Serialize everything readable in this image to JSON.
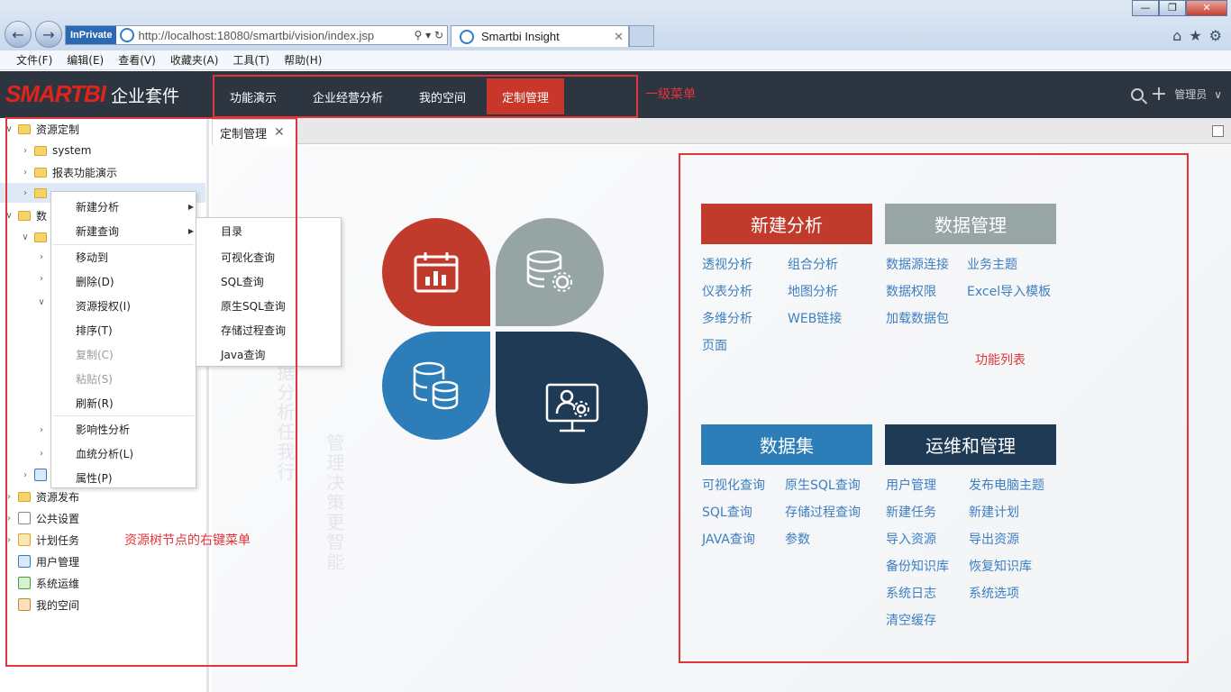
{
  "browser": {
    "inprivate": "InPrivate",
    "url": "http://localhost:18080/smartbi/vision/index.jsp",
    "tab_title": "Smartbi Insight",
    "menu": [
      "文件(F)",
      "编辑(E)",
      "查看(V)",
      "收藏夹(A)",
      "工具(T)",
      "帮助(H)"
    ]
  },
  "app": {
    "logo": "SMARTBI",
    "logo_suffix": "企业套件",
    "top_menu": [
      "功能演示",
      "企业经营分析",
      "我的空间",
      "定制管理"
    ],
    "active_menu": "定制管理",
    "user": "管理员"
  },
  "tree": {
    "items": [
      {
        "label": "资源定制"
      },
      {
        "label": "system"
      },
      {
        "label": "报表功能演示"
      },
      {
        "label": "数"
      },
      {
        "label": "资源发布"
      },
      {
        "label": "公共设置"
      },
      {
        "label": "计划任务"
      },
      {
        "label": "用户管理"
      },
      {
        "label": "系统运维"
      },
      {
        "label": "我的空间"
      }
    ]
  },
  "doc_tab": {
    "label": "定制管理"
  },
  "context_menu": {
    "items": [
      "新建分析",
      "新建查询",
      "移动到",
      "删除(D)",
      "资源授权(I)",
      "排序(T)",
      "复制(C)",
      "粘贴(S)",
      "刷新(R)",
      "影响性分析",
      "血统分析(L)",
      "属性(P)"
    ],
    "submenu": [
      "目录",
      "可视化查询",
      "SQL查询",
      "原生SQL查询",
      "存储过程查询",
      "Java查询"
    ]
  },
  "sections": {
    "new_analysis": {
      "title": "新建分析",
      "links": [
        "透视分析",
        "组合分析",
        "仪表分析",
        "地图分析",
        "多维分析",
        "WEB链接",
        "页面"
      ]
    },
    "data_mgmt": {
      "title": "数据管理",
      "links": [
        "数据源连接",
        "业务主题",
        "数据权限",
        "Excel导入模板",
        "加载数据包"
      ]
    },
    "dataset": {
      "title": "数据集",
      "links": [
        "可视化查询",
        "原生SQL查询",
        "SQL查询",
        "存储过程查询",
        "JAVA查询",
        "参数"
      ]
    },
    "ops": {
      "title": "运维和管理",
      "links": [
        "用户管理",
        "发布电脑主题",
        "新建任务",
        "新建计划",
        "导入资源",
        "导出资源",
        "备份知识库",
        "恢复知识库",
        "系统日志",
        "系统选项",
        "清空缓存"
      ]
    }
  },
  "annotations": {
    "menu": "一级菜单",
    "list": "功能列表",
    "context": "资源树节点的右键菜单"
  },
  "watermark": {
    "line1": "数据分析任我行",
    "line2": "管理决策更智能"
  },
  "colors": {
    "header_bg": "#2d3541",
    "active_menu": "#c9362a",
    "red": "#c13b2c",
    "gray": "#97a4a4",
    "blue": "#2d7db9",
    "navy": "#1f3a54",
    "link": "#3d7fc1",
    "annotation": "#e3343b"
  },
  "icons": [
    "back-icon",
    "forward-icon",
    "search-icon",
    "plus-icon",
    "chevron-down-icon",
    "home-icon",
    "star-icon",
    "gear-icon",
    "calendar-chart-icon",
    "database-gear-icon",
    "database-icon",
    "monitor-user-icon"
  ]
}
